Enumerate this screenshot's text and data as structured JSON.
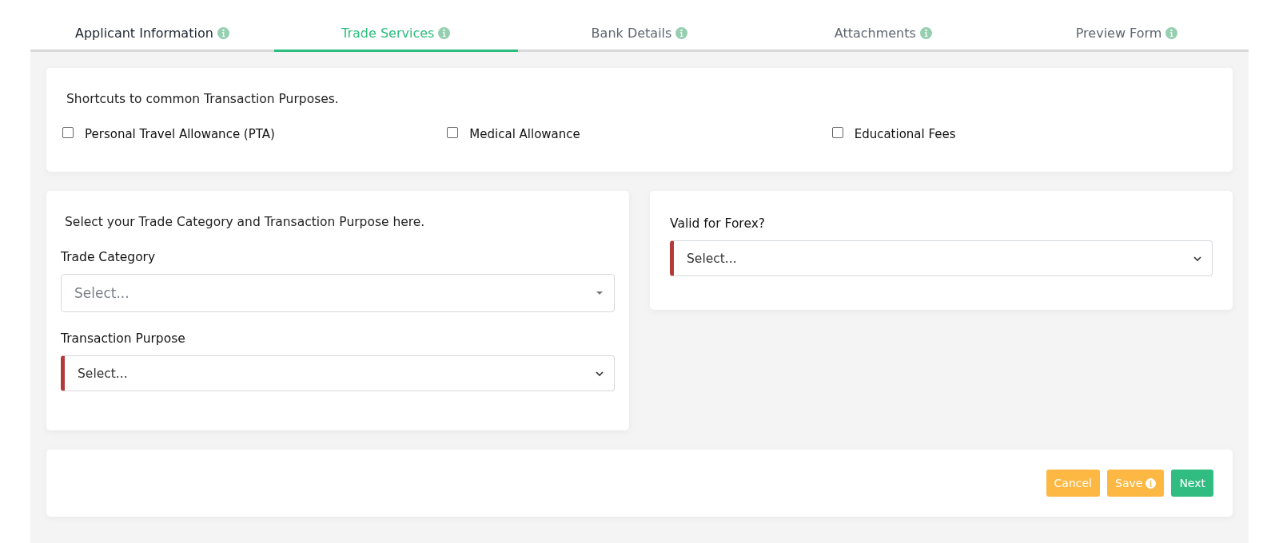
{
  "tabs": [
    {
      "label": "Applicant Information",
      "selected": false,
      "visited": true
    },
    {
      "label": "Trade Services",
      "selected": true
    },
    {
      "label": "Bank Details",
      "selected": false,
      "visited": false
    },
    {
      "label": "Attachments",
      "selected": false,
      "visited": false
    },
    {
      "label": "Preview Form",
      "selected": false,
      "visited": false
    }
  ],
  "shortcuts": {
    "title": "Shortcuts to common Transaction Purposes.",
    "options": [
      {
        "label": "Personal Travel Allowance (PTA)",
        "checked": false
      },
      {
        "label": "Medical Allowance",
        "checked": false
      },
      {
        "label": "Educational Fees",
        "checked": false
      }
    ]
  },
  "category_panel": {
    "title": "Select your Trade Category and Transaction Purpose here.",
    "fields": [
      {
        "label": "Trade Category",
        "kind": "combo",
        "required": false,
        "placeholder": "Select..."
      },
      {
        "label": "Transaction Purpose",
        "kind": "select",
        "required": true,
        "placeholder": "Select..."
      }
    ]
  },
  "forex_panel": {
    "fields": [
      {
        "label": "Valid for Forex?",
        "kind": "select",
        "required": true,
        "placeholder": "Select..."
      }
    ]
  },
  "actions": [
    {
      "label": "Cancel",
      "kind": "warning",
      "info": false
    },
    {
      "label": "Save",
      "kind": "warning",
      "info": true
    },
    {
      "label": "Next",
      "kind": "primary",
      "info": false
    }
  ]
}
